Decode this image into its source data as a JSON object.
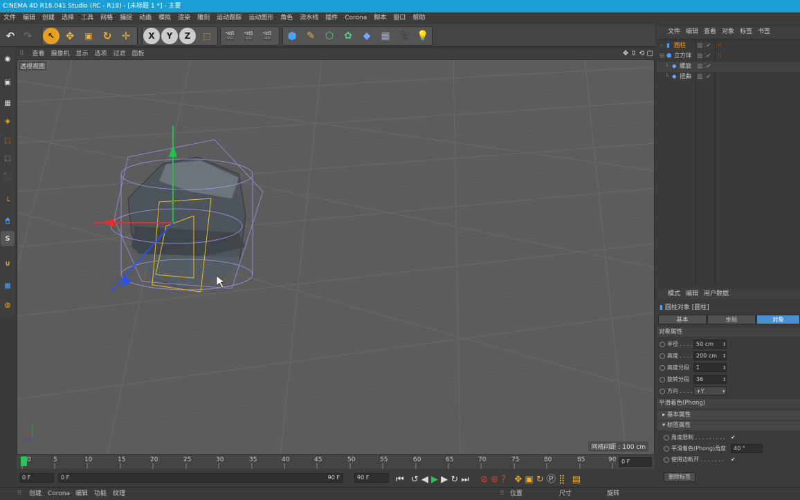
{
  "titlebar": {
    "text": "CINEMA 4D R18.041 Studio (RC - R18) - [未标题 1 *] - 主要"
  },
  "menu": [
    "文件",
    "编辑",
    "创建",
    "选择",
    "工具",
    "网格",
    "捕捉",
    "动画",
    "模拟",
    "渲染",
    "雕刻",
    "运动跟踪",
    "运动图形",
    "角色",
    "流水线",
    "插件",
    "Corona",
    "脚本",
    "窗口",
    "帮助"
  ],
  "toolbar": {
    "x": "X",
    "y": "Y",
    "z": "Z"
  },
  "viewport": {
    "menu": [
      "查看",
      "摄像机",
      "显示",
      "选项",
      "过滤",
      "面板"
    ],
    "label": "透视视图",
    "grid_info": "网格间距 : 100 cm"
  },
  "timeline": {
    "ticks": [
      "0",
      "5",
      "10",
      "15",
      "20",
      "25",
      "30",
      "35",
      "40",
      "45",
      "50",
      "55",
      "60",
      "65",
      "70",
      "75",
      "80",
      "85",
      "90"
    ],
    "current_frame": "0 F"
  },
  "transport": {
    "start": "0 F",
    "range_start": "0 F",
    "range_end": "90 F",
    "end": "90 F"
  },
  "status": {
    "items": [
      "创建",
      "Corona",
      "编辑",
      "功能",
      "纹理"
    ],
    "coords": [
      "位置",
      "尺寸",
      "旋转"
    ]
  },
  "objects": {
    "menu": [
      "文件",
      "编辑",
      "查看",
      "对象",
      "标签",
      "书签"
    ],
    "items": [
      {
        "name": "圆柱",
        "indent": 0
      },
      {
        "name": "立方体",
        "indent": 0
      },
      {
        "name": "螺旋",
        "indent": 1
      },
      {
        "name": "扭曲",
        "indent": 1
      }
    ]
  },
  "attributes": {
    "menu": [
      "模式",
      "编辑",
      "用户数据"
    ],
    "object_title": "圆柱对象 [圆柱]",
    "tabs": [
      "基本",
      "坐标",
      "对象"
    ],
    "active_tab": "对象",
    "section": "对象属性",
    "props": [
      {
        "label": "半径 . . . .",
        "value": "50 cm"
      },
      {
        "label": "高度 . . . .",
        "value": "200 cm"
      },
      {
        "label": "高度分段",
        "value": "1"
      },
      {
        "label": "旋转分段",
        "value": "36"
      },
      {
        "label": "方向 . . . .",
        "value": "+Y"
      }
    ],
    "phong": "平滑着色(Phong)",
    "basic_props": "基本属性",
    "tag_props": "标签属性",
    "tag_items": [
      {
        "label": "角度限制 . . . . . . . . .",
        "value": "✔"
      },
      {
        "label": "平滑着色(Phong)角度",
        "value": "40 °"
      },
      {
        "label": "使用边断开 . . . . . . .",
        "value": "✔"
      }
    ],
    "delete_tag": "删除标签"
  }
}
